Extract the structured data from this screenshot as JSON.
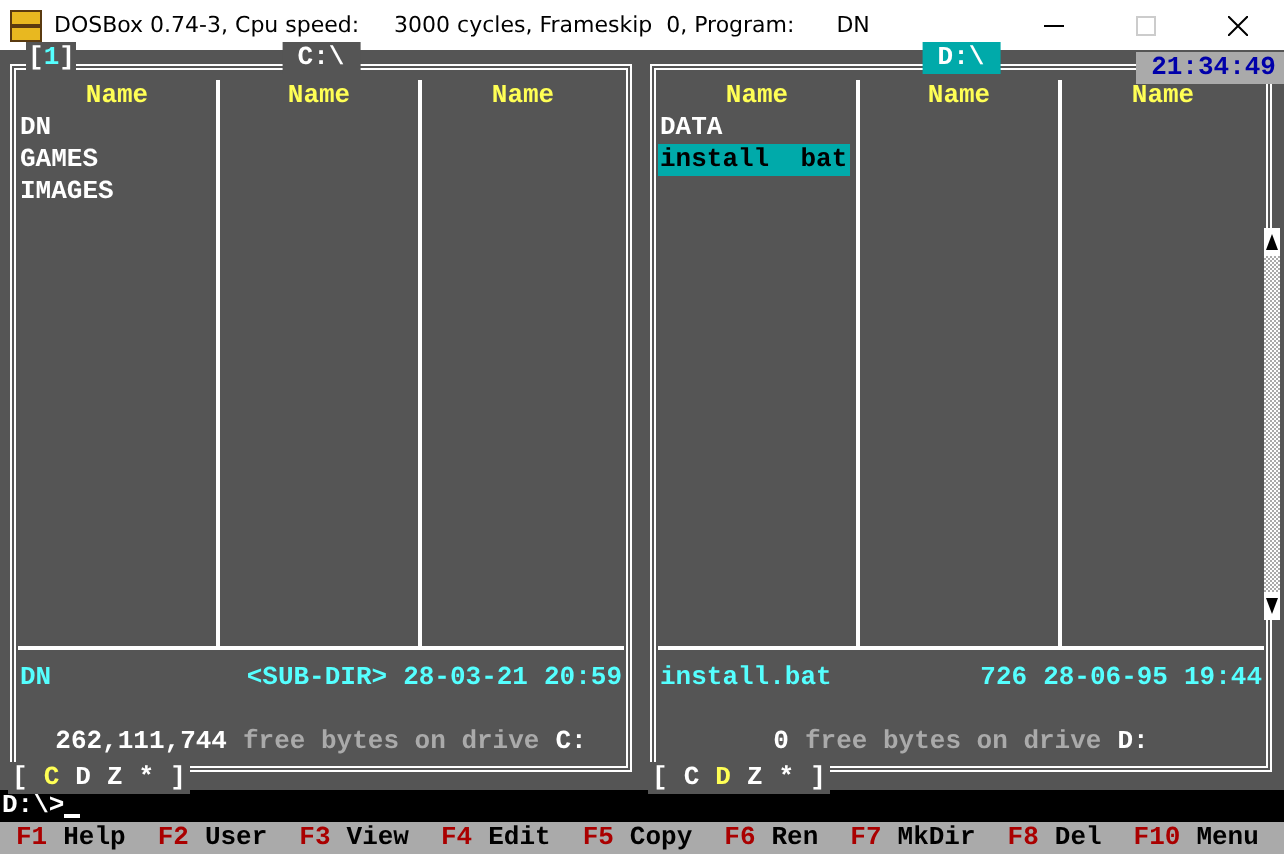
{
  "window": {
    "title": "DOSBox 0.74-3, Cpu speed:     3000 cycles, Frameskip  0, Program:      DN"
  },
  "clock": "21:34:49",
  "panels": [
    {
      "number": {
        "open": "[",
        "digit": "1",
        "close": "]"
      },
      "path": {
        "text": "C:\\",
        "selected": false
      },
      "columns": [
        "Name",
        "Name",
        "Name"
      ],
      "files": [
        {
          "name": "DN",
          "selected": false
        },
        {
          "name": "GAMES",
          "selected": false
        },
        {
          "name": "IMAGES",
          "selected": false
        }
      ],
      "info": {
        "name": "DN",
        "size": "<SUB-DIR>",
        "date": "28-03-21",
        "time": "20:59"
      },
      "free": {
        "bytes": "262,111,744",
        "text": "free bytes on drive",
        "drive": "C:"
      },
      "drives": {
        "open": "[",
        "items": [
          {
            "label": "C",
            "selected": true
          },
          {
            "label": "D",
            "selected": false
          },
          {
            "label": "Z",
            "selected": false
          },
          {
            "label": "*",
            "selected": false
          }
        ],
        "close": "]"
      }
    },
    {
      "path": {
        "text": "D:\\",
        "selected": true
      },
      "columns": [
        "Name",
        "Name",
        "Name"
      ],
      "files": [
        {
          "name": "DATA",
          "selected": false
        },
        {
          "name": "install  bat",
          "selected": true
        }
      ],
      "info": {
        "name": "install.bat",
        "size": "726",
        "date": "28-06-95",
        "time": "19:44"
      },
      "free": {
        "bytes": "0",
        "text": "free bytes on drive",
        "drive": "D:"
      },
      "drives": {
        "open": "[",
        "items": [
          {
            "label": "C",
            "selected": false
          },
          {
            "label": "D",
            "selected": true
          },
          {
            "label": "Z",
            "selected": false
          },
          {
            "label": "*",
            "selected": false
          }
        ],
        "close": "]"
      },
      "scrollbar": true
    }
  ],
  "command_line": {
    "prompt": "D:\\>"
  },
  "function_keys": [
    {
      "key": "F1",
      "label": "Help"
    },
    {
      "key": "F2",
      "label": "User"
    },
    {
      "key": "F3",
      "label": "View"
    },
    {
      "key": "F4",
      "label": "Edit"
    },
    {
      "key": "F5",
      "label": "Copy"
    },
    {
      "key": "F6",
      "label": "Ren"
    },
    {
      "key": "F7",
      "label": "MkDir"
    },
    {
      "key": "F8",
      "label": "Del"
    },
    {
      "key": "F10",
      "label": "Menu"
    }
  ]
}
